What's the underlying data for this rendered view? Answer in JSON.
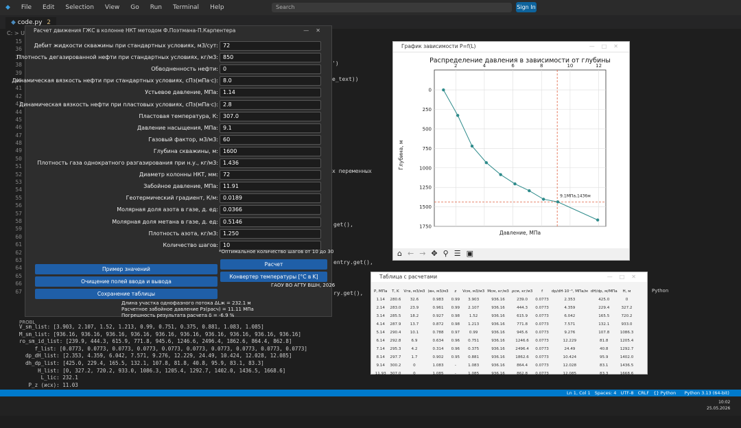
{
  "menu": [
    "File",
    "Edit",
    "Selection",
    "View",
    "Go",
    "Run",
    "Terminal",
    "Help"
  ],
  "search_placeholder": "Search",
  "signin_label": "Sign In",
  "tab": {
    "name": "code.py",
    "badge": "2"
  },
  "breadcrumb": "C: > U",
  "line_numbers": [
    "15",
    "36",
    "37",
    "38",
    "39",
    "40",
    "41",
    "42",
    "43",
    "44",
    "45",
    "46",
    "47",
    "48",
    "49",
    "50",
    "51",
    "52",
    "53",
    "54",
    "55",
    "56",
    "57",
    "58",
    "59",
    "60",
    "61",
    "62",
    "63",
    "64",
    "65",
    "66",
    "67"
  ],
  "code_fragments": [
    "')",
    "e_text))",
    "х переменных",
    "get(),",
    "entry.get(),",
    "ry.get(),"
  ],
  "problems_label": "PROBL",
  "terminal_lines": [
    "V_sm_list: [3.903, 2.107, 1.52, 1.213, 0.99, 0.751, 0.375, 0.881, 1.083, 1.085]",
    "M_sm_list: [936.16, 936.16, 936.16, 936.16, 936.16, 936.16, 936.16, 936.16, 936.16, 936.16]",
    "ro_sm_id_list: [239.9, 444.3, 615.9, 771.8, 945.6, 1246.6, 2496.4, 1862.6, 864.4, 862.8]",
    "     f_list: [0.0773, 0.0773, 0.0773, 0.0773, 0.0773, 0.0773, 0.0773, 0.0773, 0.0773, 0.0773]",
    "  dp_dH_list: [2.353, 4.359, 6.042, 7.571, 9.276, 12.229, 24.49, 10.424, 12.028, 12.085]",
    "  dh_dp_list: [425.0, 229.4, 165.5, 132.1, 107.8, 81.8, 40.8, 95.9, 83.1, 83.3]",
    "      H_list: [0, 327.2, 720.2, 933.0, 1086.3, 1205.4, 1292.7, 1402.0, 1436.5, 1668.6]",
    "       L_lic: 232.1",
    "   P_z (исх): 11.03",
    "    P_z_rach: 11.11",
    "     delta_P: -6.9%",
    "L_c_rasch = H_list[-2] + L_lic: 1668.6 + 1436.5 + 232.1"
  ],
  "status_text": "Ln 1, Col 1   Spaces: 4   UTF-8   CRLF   {} Python      Python 3.13 (64-bit)",
  "clock": {
    "time": "10:02",
    "date": "25.05.2026"
  },
  "form": {
    "title": "Расчет движения ГЖС в колонне НКТ методом Ф.Поэтмана-П.Карпентера",
    "fields": [
      {
        "label": "Дебит жидкости скважины при стандартных условиях, м3/сут:",
        "value": "72"
      },
      {
        "label": "Плотность дегазированной нефти при стандартных условиях, кг/м3:",
        "value": "850"
      },
      {
        "label": "Обводненность нефти:",
        "value": "0"
      },
      {
        "label": "Динамическая вязкость нефти при стандартных условиях, сПз(мПа·с):",
        "value": "8.0"
      },
      {
        "label": "Устьевое давление, МПа:",
        "value": "1.14"
      },
      {
        "label": "Динамическая вязкость нефти при пластовых условиях, сПз(мПа·с):",
        "value": "2.8"
      },
      {
        "label": "Пластовая температура, К:",
        "value": "307.0"
      },
      {
        "label": "Давление насыщения, МПа:",
        "value": "9.1"
      },
      {
        "label": "Газовый фактор, м3/м3:",
        "value": "60"
      },
      {
        "label": "Глубина скважины, м:",
        "value": "1600"
      },
      {
        "label": "Плотность газа однократного разгазирования при н.у., кг/м3:",
        "value": "1.436"
      },
      {
        "label": "Диаметр колонны НКТ, мм:",
        "value": "72"
      },
      {
        "label": "Забойное давление, МПа:",
        "value": "11.91"
      },
      {
        "label": "Геотермический градиент, К/м:",
        "value": "0.0189"
      },
      {
        "label": "Молярная доля азота в газе, д. ед:",
        "value": "0.0366"
      },
      {
        "label": "Молярная доля метана в газе, д. ед:",
        "value": "0.5146"
      },
      {
        "label": "Плотность азота, кг/м3:",
        "value": "1.250"
      },
      {
        "label": "Количество шагов:",
        "value": "10"
      }
    ],
    "hint": "*Оптимальное количество шагов от 10 до 30",
    "btn_example": "Пример значений",
    "btn_calc": "Расчет",
    "btn_clear": "Очищение полей ввода и вывода",
    "btn_convert": "Конвертер температуры [°C в K]",
    "btn_save": "Сохранение таблицы",
    "org": "ГАОУ ВО АГТУ ВШН, 2026",
    "result1": "Длина участка однофазного потока ΔLж = 232.1 м",
    "result2": "Расчетное забойное давление Pз(расч) = 11.11 МПа",
    "result3": "Погрешность результата расчета δ = -6.9 %"
  },
  "plot": {
    "window_title": "График зависимости P=f(L)",
    "toolbar_icons": [
      "home-icon",
      "back-icon",
      "forward-icon",
      "pan-icon",
      "zoom-icon",
      "configure-icon",
      "save-icon"
    ]
  },
  "chart_data": {
    "type": "line",
    "title": "Распределение давления в зависимости от глубины",
    "xlabel": "Давление, МПа",
    "ylabel": "Глубина, м",
    "x_ticks": [
      2,
      4,
      6,
      8,
      10,
      12
    ],
    "y_ticks": [
      0,
      250,
      500,
      750,
      1000,
      1250,
      1500,
      1750
    ],
    "xlim": [
      0.5,
      12.5
    ],
    "ylim": [
      1750,
      -80
    ],
    "x_axis_position": "top",
    "grid": true,
    "series": [
      {
        "x": [
          1.14,
          2.14,
          3.14,
          4.14,
          5.14,
          6.14,
          7.14,
          8.14,
          9.14,
          11.93
        ],
        "y": [
          0,
          327.2,
          720.2,
          933.0,
          1086.3,
          1205.4,
          1292.7,
          1402.0,
          1436.5,
          1668.6
        ],
        "color": "#2e8b8b"
      }
    ],
    "reference_lines": {
      "vertical_x": 9.1,
      "horizontal_y": 1436.5
    },
    "annotation": "9.1МПа,1436м"
  },
  "table": {
    "window_title": "Таблица с расчетами",
    "headers": [
      "P, МПа",
      "T, K",
      "Vгв, м3/м3",
      "(вн, м3/м3",
      "z",
      "Vсм, м3/м3",
      "Mсм, кг/м3",
      "ρсм, кг/м3",
      "f",
      "dp/dH·10⁻³, МПа/м",
      "dH/dp, м/МПа",
      "H, м"
    ],
    "rows": [
      [
        "1.14",
        "280.6",
        "32.6",
        "0.983",
        "0.99",
        "3.903",
        "936.16",
        "239.0",
        "0.0773",
        "2.353",
        "425.0",
        "0"
      ],
      [
        "2.14",
        "283.0",
        "23.9",
        "0.961",
        "0.99",
        "2.107",
        "936.16",
        "444.3",
        "0.0773",
        "4.359",
        "229.4",
        "327.2"
      ],
      [
        "3.14",
        "285.5",
        "18.2",
        "0.927",
        "0.98",
        "1.52",
        "936.16",
        "615.9",
        "0.0773",
        "6.042",
        "165.5",
        "720.2"
      ],
      [
        "4.14",
        "287.9",
        "13.7",
        "0.872",
        "0.98",
        "1.213",
        "936.16",
        "771.8",
        "0.0773",
        "7.571",
        "132.1",
        "933.0"
      ],
      [
        "5.14",
        "290.4",
        "10.1",
        "0.788",
        "0.97",
        "0.99",
        "936.16",
        "945.6",
        "0.0773",
        "9.276",
        "107.8",
        "1086.3"
      ],
      [
        "6.14",
        "292.8",
        "6.9",
        "0.634",
        "0.96",
        "0.751",
        "936.16",
        "1246.6",
        "0.0773",
        "12.229",
        "81.8",
        "1205.4"
      ],
      [
        "7.14",
        "295.3",
        "4.2",
        "0.314",
        "0.96",
        "0.375",
        "936.16",
        "2496.4",
        "0.0773",
        "24.49",
        "40.8",
        "1292.7"
      ],
      [
        "8.14",
        "297.7",
        "1.7",
        "0.902",
        "0.95",
        "0.881",
        "936.16",
        "1862.6",
        "0.0773",
        "10.424",
        "95.9",
        "1402.0"
      ],
      [
        "9.14",
        "300.2",
        "0",
        "1.083",
        "-",
        "1.083",
        "936.16",
        "864.4",
        "0.0773",
        "12.028",
        "83.1",
        "1436.5"
      ],
      [
        "11.93",
        "307.0",
        "0",
        "1.085",
        "-",
        "1.085",
        "936.16",
        "862.8",
        "0.0773",
        "12.085",
        "83.3",
        "1668.6"
      ]
    ]
  },
  "side_panel": {
    "label": "Python"
  }
}
